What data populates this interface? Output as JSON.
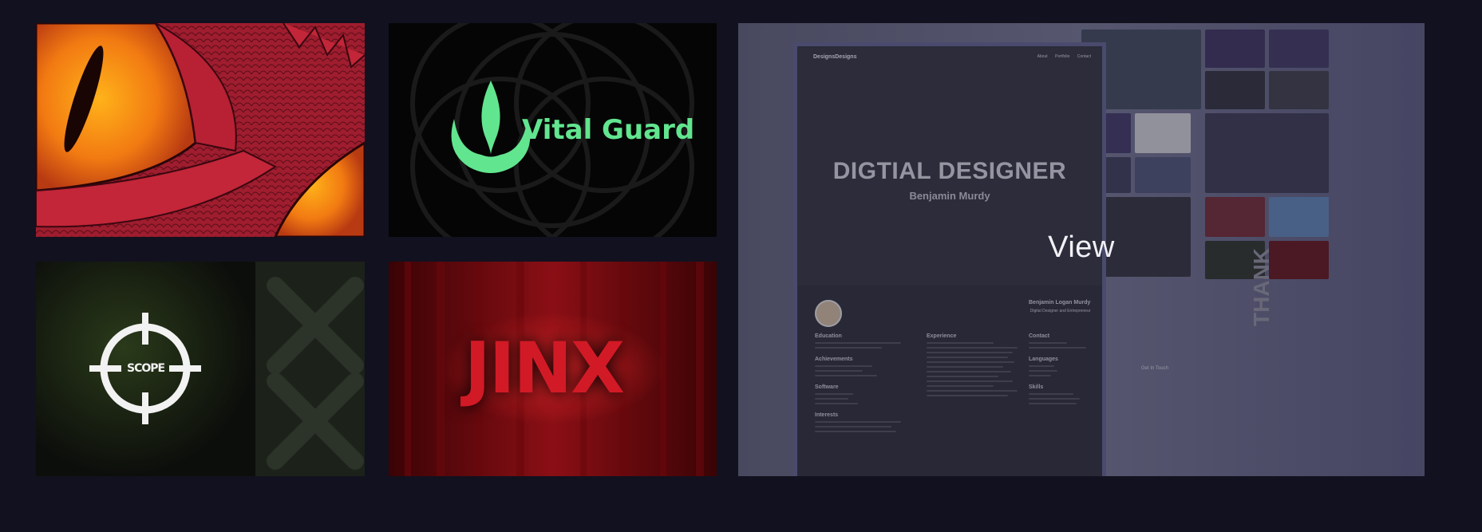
{
  "gallery": {
    "view_label": "View",
    "tiles": [
      {
        "name": "dragon-eye-artwork"
      },
      {
        "name": "vital-guard-logo",
        "text": "Vital Guard"
      },
      {
        "name": "scope-logo",
        "text": "SCOPE"
      },
      {
        "name": "jinx-logo",
        "text": "JINX"
      },
      {
        "name": "portfolio-preview"
      }
    ]
  },
  "portfolio": {
    "brand": "DesignsDesigns",
    "nav": [
      "About",
      "Portfolio",
      "Contact"
    ],
    "hero_title": "DIGTIAL DESIGNER",
    "hero_subtitle": "Benjamin Murdy",
    "resume_name": "Benjamin Logan Murdy",
    "resume_role": "Digital Designer and Entrepreneur",
    "sections_left": [
      "Education",
      "Achievements",
      "Software",
      "Interests"
    ],
    "sections_mid": [
      "Experience"
    ],
    "sections_right": [
      "Contact",
      "Languages",
      "Skills"
    ],
    "get_in_touch": "Get In Touch",
    "thank": "THANK"
  },
  "colors": {
    "background": "#12111f",
    "vital_green": "#62e58f",
    "jinx_red": "#d21a26"
  }
}
